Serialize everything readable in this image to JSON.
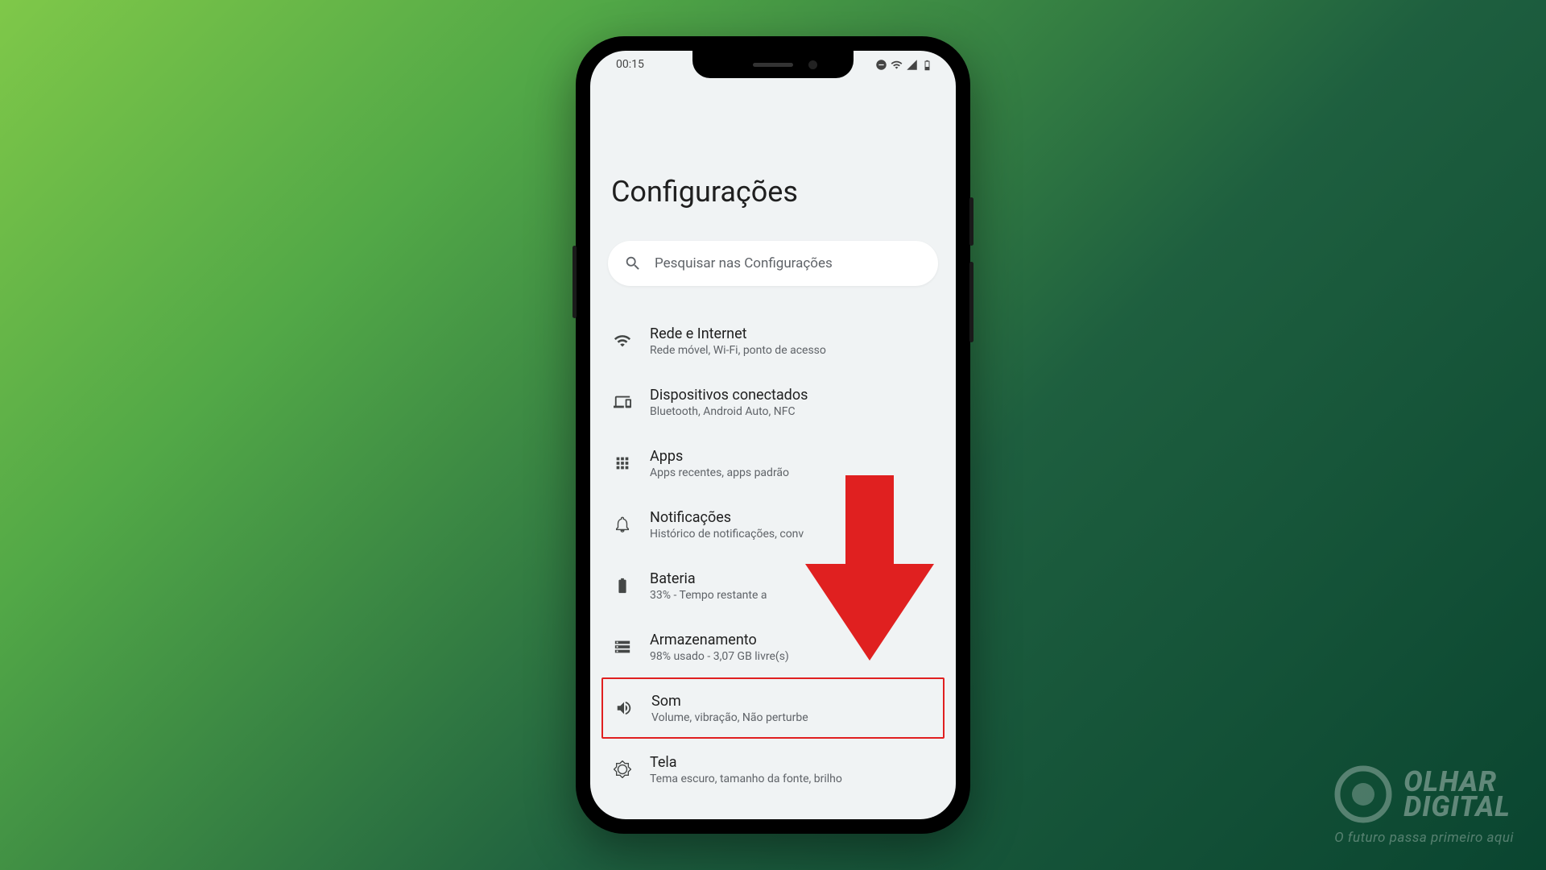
{
  "status": {
    "time": "00:15"
  },
  "page": {
    "title": "Configurações"
  },
  "search": {
    "placeholder": "Pesquisar nas Configurações"
  },
  "settings": [
    {
      "title": "Rede e Internet",
      "subtitle": "Rede móvel, Wi-Fi, ponto de acesso"
    },
    {
      "title": "Dispositivos conectados",
      "subtitle": "Bluetooth, Android Auto, NFC"
    },
    {
      "title": "Apps",
      "subtitle": "Apps recentes, apps padrão"
    },
    {
      "title": "Notificações",
      "subtitle": "Histórico de notificações, conv"
    },
    {
      "title": "Bateria",
      "subtitle": "33% - Tempo restante a"
    },
    {
      "title": "Armazenamento",
      "subtitle": "98% usado - 3,07 GB livre(s)"
    },
    {
      "title": "Som",
      "subtitle": "Volume, vibração, Não perturbe"
    },
    {
      "title": "Tela",
      "subtitle": "Tema escuro, tamanho da fonte, brilho"
    }
  ],
  "watermark": {
    "line1": "OLHAR",
    "line2": "DIGITAL",
    "slogan": "O futuro passa primeiro aqui"
  }
}
